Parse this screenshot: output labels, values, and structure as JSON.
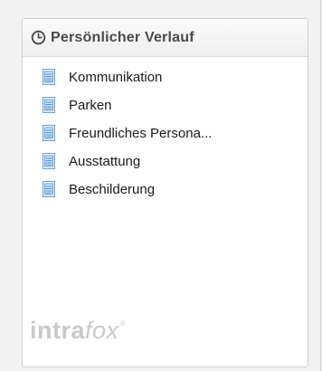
{
  "panel": {
    "title": "Persönlicher Verlauf",
    "title_icon": "clock-icon",
    "items": [
      {
        "label": "Kommunikation",
        "icon": "document-icon"
      },
      {
        "label": "Parken",
        "icon": "document-icon"
      },
      {
        "label": "Freundliches Persona...",
        "icon": "document-icon"
      },
      {
        "label": "Ausstattung",
        "icon": "document-icon"
      },
      {
        "label": "Beschilderung",
        "icon": "document-icon"
      }
    ]
  },
  "logo": {
    "part1": "intra",
    "part2": "fox",
    "mark": "®"
  },
  "colors": {
    "header_text": "#4a4a4a",
    "logo": "#c9c9c9",
    "icon_blue": "#4a8fd0"
  }
}
